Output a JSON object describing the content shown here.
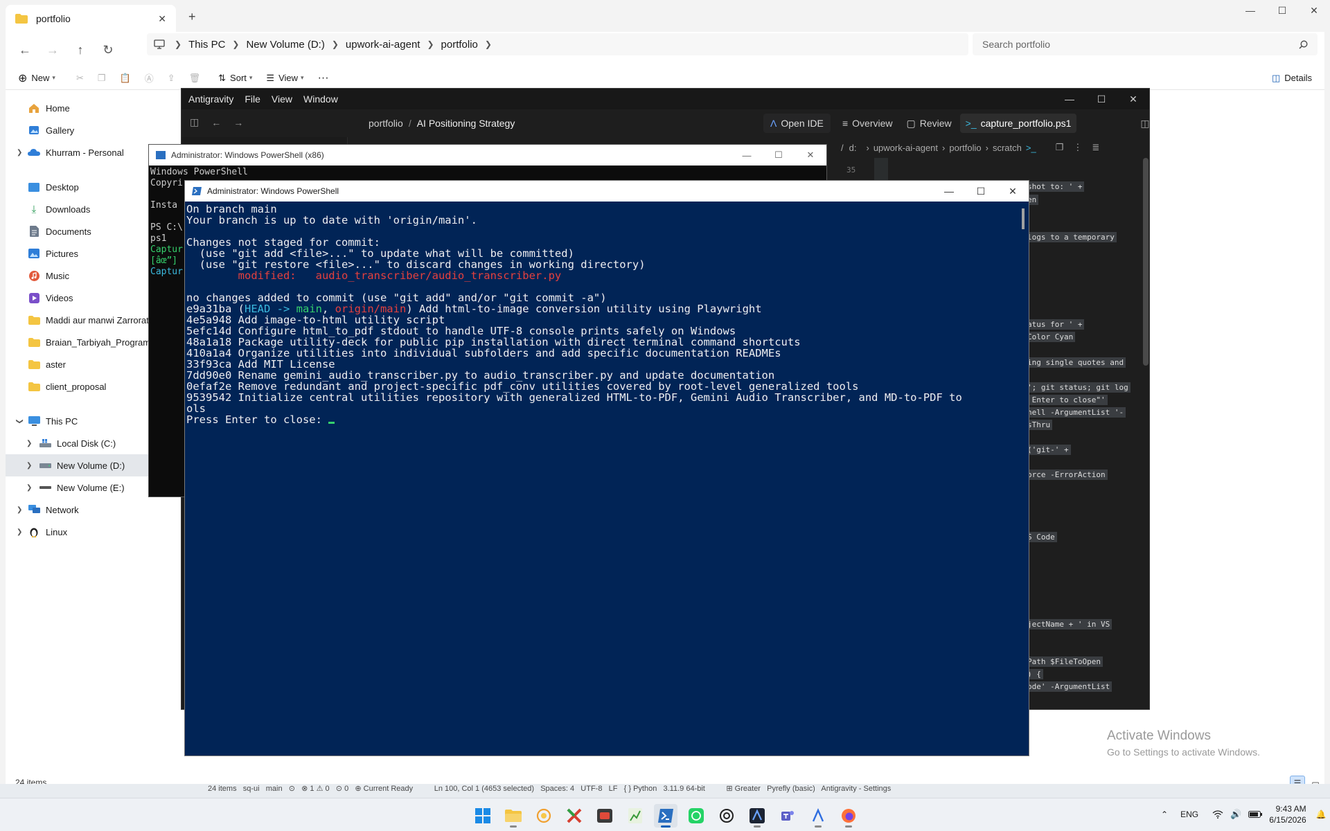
{
  "explorer": {
    "tab_title": "portfolio",
    "new_tab": "+",
    "breadcrumb": [
      "This PC",
      "New Volume (D:)",
      "upwork-ai-agent",
      "portfolio"
    ],
    "search_placeholder": "Search portfolio",
    "commands": {
      "new": "New",
      "sort": "Sort",
      "view": "View",
      "more": "···",
      "details": "Details"
    },
    "nav": {
      "home": "Home",
      "gallery": "Gallery",
      "onedrive": "Khurram - Personal",
      "desktop": "Desktop",
      "downloads": "Downloads",
      "documents": "Documents",
      "pictures": "Pictures",
      "music": "Music",
      "videos": "Videos",
      "folder1": "Maddi aur manwi Zarrorat",
      "folder2": "Braian_Tarbiyah_Program",
      "folder3": "aster",
      "folder4": "client_proposal",
      "this_pc": "This PC",
      "drive_c": "Local Disk (C:)",
      "drive_d": "New Volume (D:)",
      "drive_e": "New Volume (E:)",
      "network": "Network",
      "linux": "Linux"
    },
    "status_count": "24 items"
  },
  "antigravity": {
    "menu": [
      "Antigravity",
      "File",
      "View",
      "Window"
    ],
    "breadcrumb_project": "portfolio",
    "breadcrumb_sep": "/",
    "breadcrumb_page": "AI Positioning Strategy",
    "open_ide": "Open IDE",
    "tabs": {
      "overview": "Overview",
      "review": "Review",
      "file": "capture_portfolio.ps1"
    },
    "editor_crumb": [
      "/",
      "d:",
      "upwork-ai-agent",
      "portfolio",
      "scratch"
    ],
    "line_number": "35",
    "code_fragments": [
      "shot to: ' +",
      "en",
      "logs to a temporary",
      "atus for ' +",
      "Color Cyan",
      "ing single quotes and",
      "'; git status; git log",
      " Enter to close\"'",
      "hell -ArgumentList '-",
      "sThru",
      "('git-' +",
      "orce -ErrorAction",
      "S Code",
      "jectName + ' in VS",
      "Path $FileToOpen",
      ") {",
      "ode' -ArgumentList"
    ]
  },
  "ps86": {
    "title": "Administrator: Windows PowerShell (x86)",
    "lines": [
      "Windows PowerShell",
      "Copyri",
      "",
      "Insta",
      "",
      "PS C:\\",
      "ps1",
      "Captur",
      "[âœ”] ",
      "Captur"
    ]
  },
  "powershell": {
    "title": "Administrator: Windows PowerShell",
    "lines": {
      "l1": "On branch main",
      "l2": "Your branch is up to date with 'origin/main'.",
      "l3": "Changes not staged for commit:",
      "l4": "  (use \"git add <file>...\" to update what will be committed)",
      "l5": "  (use \"git restore <file>...\" to discard changes in working directory)",
      "l6_indent": "        ",
      "l6": "modified:   audio_transcriber/audio_transcriber.py",
      "l7": "no changes added to commit (use \"git add\" and/or \"git commit -a\")",
      "c1_hash": "e9a31ba ",
      "c1_p1": "(",
      "c1_head": "HEAD -> ",
      "c1_main": "main",
      "c1_comma": ", ",
      "c1_origin": "origin/main",
      "c1_msg": ") Add html-to-image conversion utility using Playwright",
      "c2": "4e5a948 Add image-to-html utility script",
      "c3": "5efc14d Configure html_to_pdf stdout to handle UTF-8 console prints safely on Windows",
      "c4": "48a1a18 Package utility-deck for public pip installation with direct terminal command shortcuts",
      "c5": "410a1a4 Organize utilities into individual subfolders and add specific documentation READMEs",
      "c6": "33f93ca Add MIT License",
      "c7": "7dd90e0 Rename gemini_audio_transcriber.py to audio_transcriber.py and update documentation",
      "c8": "0efaf2e Remove redundant and project-specific pdf_conv utilities covered by root-level generalized tools",
      "c9": "9539542 Initialize central utilities repository with generalized HTML-to-PDF, Gemini Audio Transcriber, and MD-to-PDF to",
      "c9b": "ols",
      "prompt": "Press Enter to close: "
    }
  },
  "watermark": {
    "line1": "Activate Windows",
    "line2": "Go to Settings to activate Windows."
  },
  "bottom_strip": "24 items   sq-ui   main   ⊙   ⊗ 1 ⚠ 0   ⊙ 0   ⊕ Current Ready          Ln 100, Col 1 (4653 selected)   Spaces: 4   UTF-8   LF   { } Python   3.11.9 64-bit          ⊞ Greater   Pyrefly (basic)   Antigravity - Settings",
  "taskbar": {
    "lang": "ENG",
    "time": "9:43 AM",
    "date": "6/15/2026"
  },
  "colors": {
    "ps_bg": "#012456",
    "accent": "#005fb8",
    "git_red": "#e5403e",
    "git_cyan": "#3bb9de",
    "git_green": "#35d06c"
  }
}
